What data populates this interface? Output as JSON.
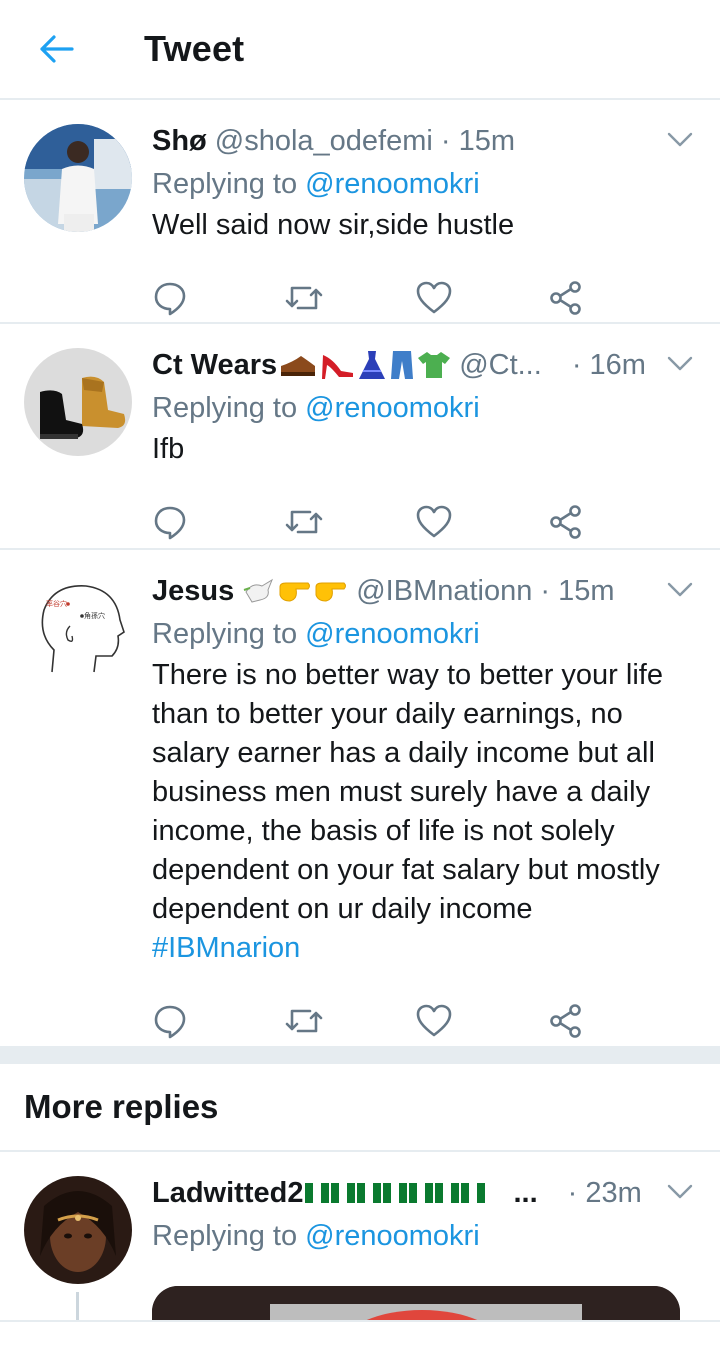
{
  "header": {
    "title": "Tweet",
    "back_icon": "back-arrow-icon",
    "accent": "#1da1f2"
  },
  "tweets": [
    {
      "name": "Shø",
      "handle": "@shola_odefemi",
      "time": "· 15m",
      "replying_label": "Replying to",
      "replying_to": "@renoomokri",
      "text": "Well said now sir,side hustle"
    },
    {
      "name": "Ct Wears",
      "name_emojis": [
        "shoe",
        "high-heel",
        "dress",
        "jeans",
        "tshirt"
      ],
      "handle": "@Ct...",
      "time": "· 16m",
      "replying_label": "Replying to",
      "replying_to": "@renoomokri",
      "text": "Ifb"
    },
    {
      "name": "Jesus",
      "name_emojis": [
        "dove",
        "point-right",
        "point-right"
      ],
      "handle": "@IBMnationn",
      "time": "· 15m",
      "replying_label": "Replying to",
      "replying_to": "@renoomokri",
      "text": "There is no better way to better your life than to better your daily earnings, no salary earner has a daily income but all business men must surely have a daily income, the basis of life is not solely dependent on your fat salary but mostly dependent on ur daily income",
      "hashtag": "#IBMnarion",
      "avatar_text_1": "率谷穴",
      "avatar_text_2": "角孫穴"
    }
  ],
  "more_replies": {
    "title": "More replies",
    "tweet": {
      "name": "Ladwitted2",
      "name_suffix": "...",
      "time": "· 23m",
      "replying_label": "Replying to",
      "replying_to": "@renoomokri"
    }
  },
  "colors": {
    "link": "#1b95e0",
    "secondary_text": "#657786",
    "divider": "#e6ecf0",
    "icon": "#657786"
  }
}
